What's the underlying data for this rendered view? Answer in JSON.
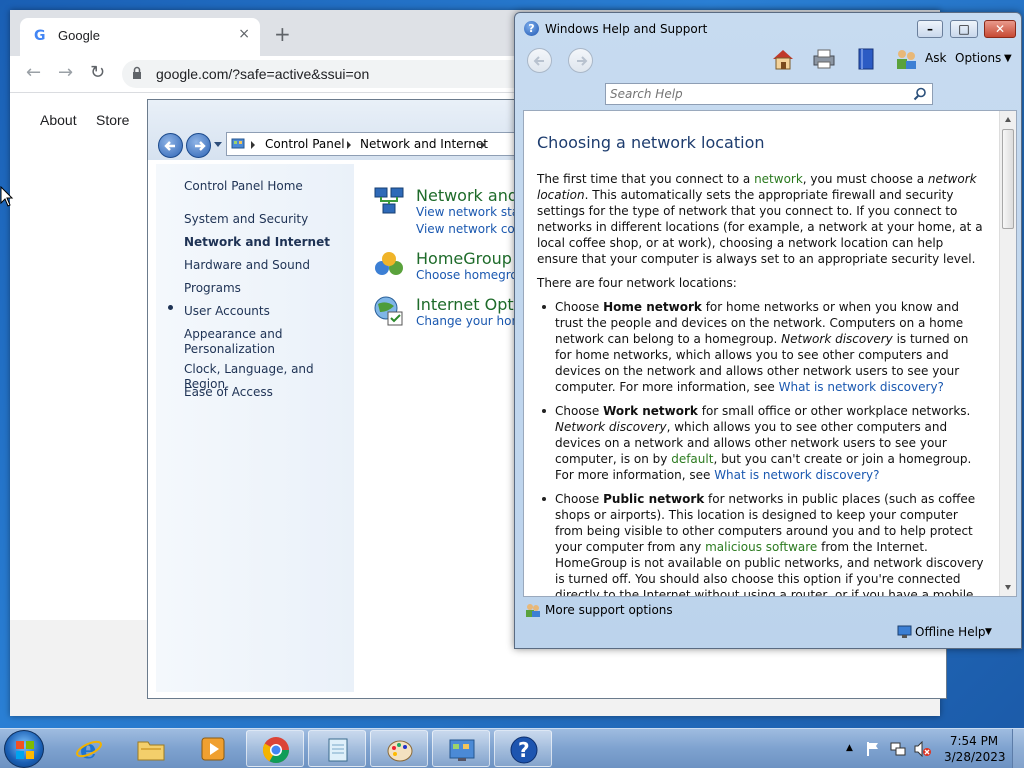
{
  "chrome": {
    "tab_title": "Google",
    "tab_close": "×",
    "new_tab": "+",
    "url": "google.com/?safe=active&ssui=on",
    "links": {
      "about": "About",
      "store": "Store"
    }
  },
  "control_panel": {
    "breadcrumbs": [
      "Control Panel",
      "Network and Internet"
    ],
    "sidebar": [
      "Control Panel Home",
      "System and Security",
      "Network and Internet",
      "Hardware and Sound",
      "Programs",
      "User Accounts",
      "Appearance and Personalization",
      "Clock, Language, and Region",
      "Ease of Access"
    ],
    "sidebar_appearance_line1": "Appearance and",
    "sidebar_appearance_line2": "Personalization",
    "categories": [
      {
        "title": "Network and S",
        "links": [
          "View network statu",
          "View network com"
        ]
      },
      {
        "title": "HomeGroup",
        "links": [
          "Choose homegrou"
        ]
      },
      {
        "title": "Internet Optio",
        "links": [
          "Change your hom"
        ]
      }
    ]
  },
  "help": {
    "title": "Windows Help and Support",
    "toolbar": {
      "ask": "Ask",
      "options": "Options"
    },
    "search_placeholder": "Search Help",
    "heading": "Choosing a network location",
    "intro": {
      "p1_a": "The first time that you connect to a ",
      "p1_link": "network",
      "p1_b": ", you must choose a ",
      "p1_em": "network location",
      "p1_c": ". This automatically sets the appropriate firewall and security settings for the type of network that you connect to. If you connect to networks in different locations (for example, a network at your home, at a local coffee shop, or at work), choosing a network location can help ensure that your computer is always set to an appropriate security level.",
      "p2": "There are four network locations:"
    },
    "home": {
      "a": "Choose ",
      "b": "Home network",
      "c": " for home networks or when you know and trust the people and devices on the network. Computers on a home network can belong to a homegroup. ",
      "d": "Network discovery",
      "e": " is turned on for home networks, which allows you to see other computers and devices on the network and allows other network users to see your computer. For more information, see ",
      "link": "What is network discovery?"
    },
    "work": {
      "a": "Choose ",
      "b": "Work network",
      "c": " for small office or other workplace networks. ",
      "d": "Network discovery",
      "e": ", which allows you to see other computers and devices on a network and allows other network users to see your computer, is on by ",
      "glink": "default",
      "f": ", but you can't create or join a homegroup. For more information, see ",
      "link": "What is network discovery?"
    },
    "public": {
      "a": "Choose ",
      "b": "Public network",
      "c": " for networks in public places (such as coffee shops or airports). This location is designed to keep your computer from being visible to other computers around you and to help protect your computer from any ",
      "glink": "malicious software",
      "d": " from the Internet. HomeGroup is not available on public networks, and network discovery is turned off. You should also choose this option if you're connected directly to the Internet without using a router, or if you have a mobile broadband connection."
    },
    "more_support": "More support options",
    "offline_help": "Offline Help"
  },
  "taskbar": {
    "time": "7:54 PM",
    "date": "3/28/2023"
  }
}
